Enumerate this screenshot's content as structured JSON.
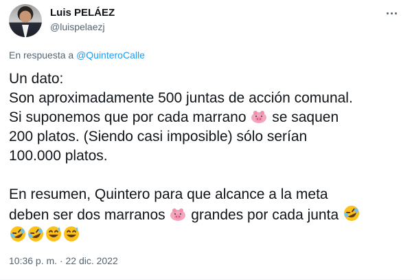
{
  "author": {
    "name": "Luis PELÁEZ",
    "handle": "@luispelaezj"
  },
  "reply": {
    "prefix": "En respuesta a ",
    "mention": "@QuinteroCalle"
  },
  "tweet": {
    "p1_l1": "Un dato:",
    "p1_l2": "Son aproximadamente 500 juntas de acción comunal.",
    "p1_l3a": "Si suponemos que por cada marrano ",
    "p1_l3b": " se saquen",
    "p1_l4": "200 platos. (Siendo casi imposible) sólo serían",
    "p1_l5": "100.000 platos.",
    "p2_l1": "En resumen, Quintero para que alcance a la meta",
    "p2_l2a": "deben ser dos marranos ",
    "p2_l2b": " grandes por cada junta "
  },
  "emojis": [
    "pig-nose",
    "rolling-laughing",
    "rolling-laughing",
    "rolling-laughing",
    "sweat-smile",
    "sweat-smile"
  ],
  "timestamp": "10:36 p. m. · 22 dic. 2022"
}
